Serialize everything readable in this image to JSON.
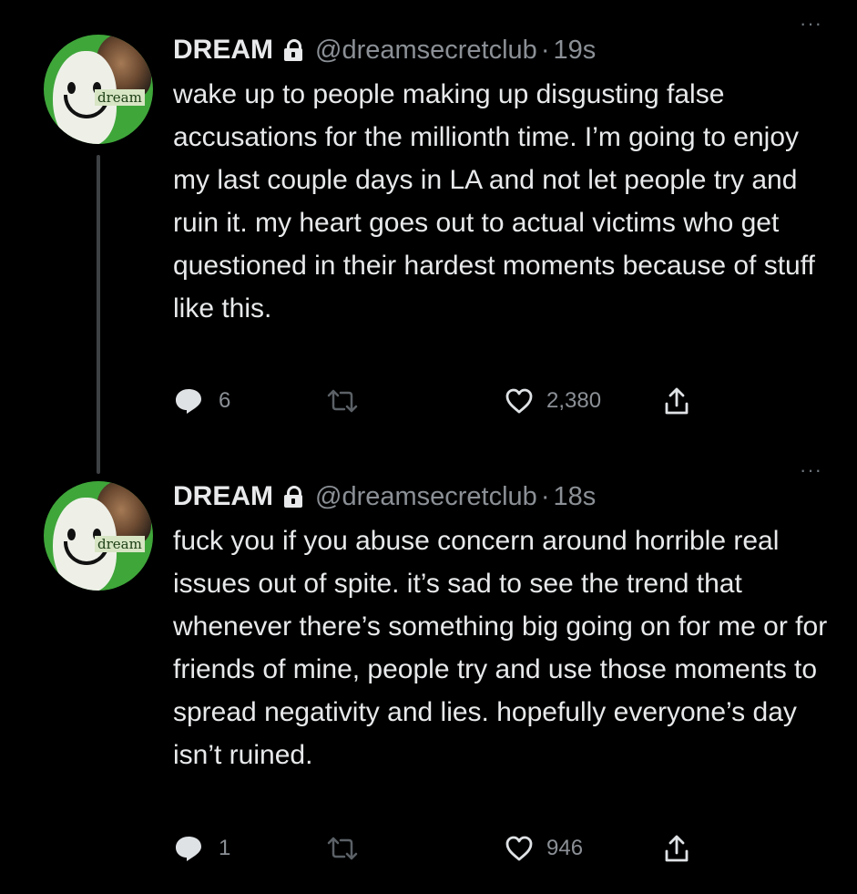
{
  "tweets": [
    {
      "display_name": "DREAM",
      "handle": "@dreamsecretclub",
      "separator": "·",
      "time": "19s",
      "avatar_label": "dream",
      "text": "wake up to people making up disgusting false accusations for the millionth time. I’m going to enjoy my last couple days in LA and not let people try and ruin it. my heart goes out to actual victims who get questioned in their hardest moments because of stuff like this.",
      "replies": "6",
      "likes": "2,380",
      "more": "···"
    },
    {
      "display_name": "DREAM",
      "handle": "@dreamsecretclub",
      "separator": "·",
      "time": "18s",
      "avatar_label": "dream",
      "text": "fuck you if you abuse concern around horrible real issues out of spite. it’s sad to see the trend that whenever there’s something big going on for me or for friends of mine, people try and use those moments to spread negativity and lies. hopefully everyone’s day isn’t ruined.",
      "replies": "1",
      "likes": "946",
      "more": "···"
    }
  ],
  "colors": {
    "background": "#000000",
    "text": "#e7e9ea",
    "muted": "#8b9096",
    "thread_line": "#3e4144",
    "avatar_green": "#3fa63a"
  },
  "icons": [
    "lock-icon",
    "more-icon",
    "reply-icon",
    "retweet-icon",
    "like-icon",
    "share-icon"
  ]
}
